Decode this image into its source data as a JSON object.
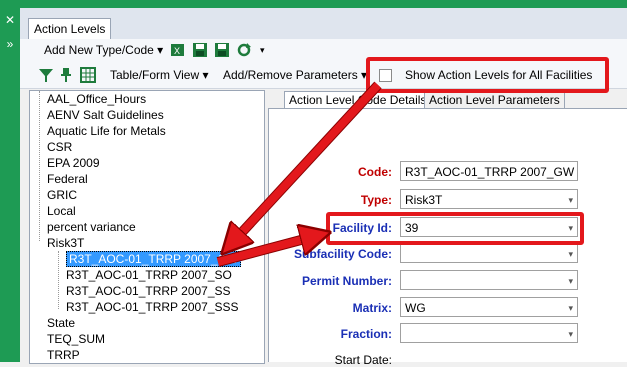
{
  "tab": {
    "label": "Action Levels"
  },
  "toolbar1": {
    "add_new_label": "Add New Type/Code ▾"
  },
  "toolbar2": {
    "table_form_view": "Table/Form View ▾",
    "add_remove_params": "Add/Remove Parameters ▾",
    "show_all_facilities": "Show Action Levels for All Facilities"
  },
  "tree": {
    "items": [
      "AAL_Office_Hours",
      "AENV Salt Guidelines",
      "Aquatic Life for Metals",
      "CSR",
      "EPA 2009",
      "Federal",
      "GRIC",
      "Local",
      "percent variance",
      "Risk3T"
    ],
    "risk3t_children": [
      "R3T_AOC-01_TRRP 2007_GW",
      "R3T_AOC-01_TRRP 2007_SO",
      "R3T_AOC-01_TRRP 2007_SS",
      "R3T_AOC-01_TRRP 2007_SSS"
    ],
    "items_after": [
      "State",
      "TEQ_SUM",
      "TRRP"
    ]
  },
  "subtabs": {
    "code_details": "Action Level Code Details",
    "parameters": "Action Level Parameters"
  },
  "form": {
    "code_label": "Code:",
    "code_value": "R3T_AOC-01_TRRP 2007_GW",
    "type_label": "Type:",
    "type_value": "Risk3T",
    "facility_label": "Facility Id:",
    "facility_value": "39",
    "subfacility_label": "Subfacility Code:",
    "subfacility_value": "",
    "permit_label": "Permit Number:",
    "permit_value": "",
    "matrix_label": "Matrix:",
    "matrix_value": "WG",
    "fraction_label": "Fraction:",
    "fraction_value": "",
    "start_date_label": "Start Date:"
  },
  "colors": {
    "accent_green": "#1e9b54",
    "annotation_red": "#e3181c",
    "selection_blue": "#3399ff"
  }
}
